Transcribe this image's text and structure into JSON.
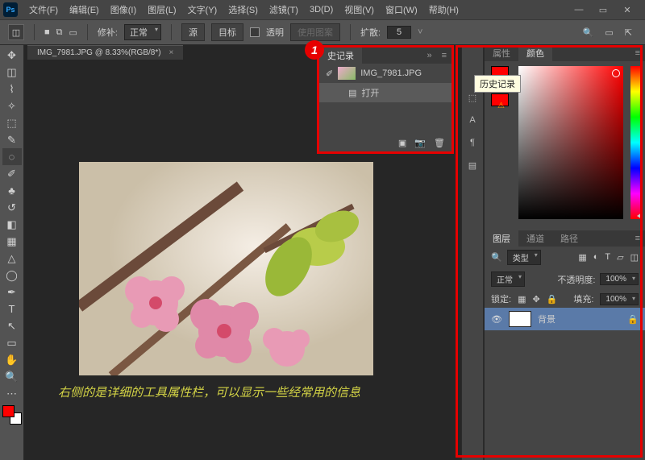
{
  "app": {
    "logo": "Ps"
  },
  "menu": {
    "file": "文件(F)",
    "edit": "编辑(E)",
    "image": "图像(I)",
    "layer": "图层(L)",
    "type": "文字(Y)",
    "select": "选择(S)",
    "filter": "滤镜(T)",
    "threed": "3D(D)",
    "view": "视图(V)",
    "window": "窗口(W)",
    "help": "帮助(H)"
  },
  "optbar": {
    "repair_label": "修补:",
    "repair_mode": "正常",
    "source": "源",
    "target": "目标",
    "transparent": "透明",
    "use_pattern": "使用图案",
    "diffuse_label": "扩散:",
    "diffuse_value": "5"
  },
  "document": {
    "tab_title": "IMG_7981.JPG @ 8.33%(RGB/8*)"
  },
  "caption": "右侧的是详细的工具属性栏，可以显示一些经常用的信息",
  "history": {
    "tab": "史记录",
    "file": "IMG_7981.JPG",
    "open": "打开"
  },
  "tooltip": "历史记录",
  "tabs": {
    "props": "属性",
    "color": "颜色",
    "layers": "图层",
    "channels": "通道",
    "paths": "路径"
  },
  "layers": {
    "kind": "类型",
    "blend": "正常",
    "opacity_label": "不透明度:",
    "opacity": "100%",
    "lock_label": "锁定:",
    "fill_label": "填充:",
    "fill": "100%",
    "background": "背景"
  },
  "marker": "1"
}
